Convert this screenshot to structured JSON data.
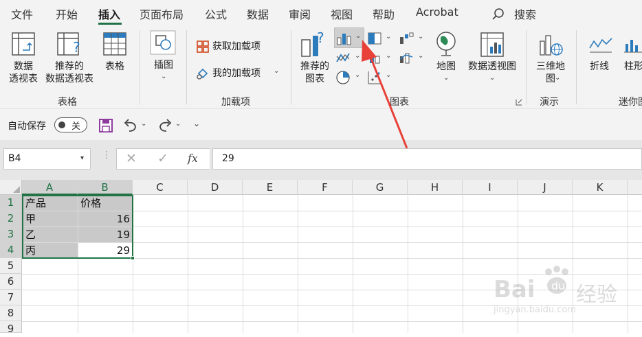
{
  "tabs": [
    "文件",
    "开始",
    "插入",
    "页面布局",
    "公式",
    "数据",
    "审阅",
    "视图",
    "帮助",
    "Acrobat"
  ],
  "search_label": "搜索",
  "ribbon": {
    "pivot_table": [
      "数据",
      "透视表"
    ],
    "recommended_pivot": [
      "推荐的",
      "数据透视表"
    ],
    "table": "表格",
    "tables_group": "表格",
    "illustrations": "插图",
    "get_addins": "获取加载项",
    "my_addins": "我的加载项",
    "addins_group": "加载项",
    "recommended_charts": [
      "推荐的",
      "图表"
    ],
    "map": "地图",
    "pivot_chart": "数据透视图",
    "charts_group": "图表",
    "map3d": [
      "三维地",
      "图"
    ],
    "tours_group": "演示",
    "line": "折线",
    "column": "柱形",
    "sparklines_group": "迷你图"
  },
  "qat": {
    "autosave_label": "自动保存",
    "autosave_state": "关"
  },
  "formula_bar": {
    "name_box": "B4",
    "fx": "fx",
    "value": "29"
  },
  "columns": [
    "A",
    "B",
    "C",
    "D",
    "E",
    "F",
    "G",
    "H",
    "I",
    "J",
    "K"
  ],
  "rows": [
    "1",
    "2",
    "3",
    "4",
    "5",
    "6",
    "7",
    "8",
    "9"
  ],
  "cells": {
    "a1": "产品",
    "b1": "价格",
    "a2": "甲",
    "b2": "16",
    "a3": "乙",
    "b3": "19",
    "a4": "丙",
    "b4": "29"
  },
  "watermark": {
    "brand": "Bai",
    "brand2": "经验",
    "url": "jingyan.baidu.com"
  },
  "colors": {
    "accent": "#217346",
    "arrow": "#e8413a",
    "selection": "#c9c9c9"
  }
}
